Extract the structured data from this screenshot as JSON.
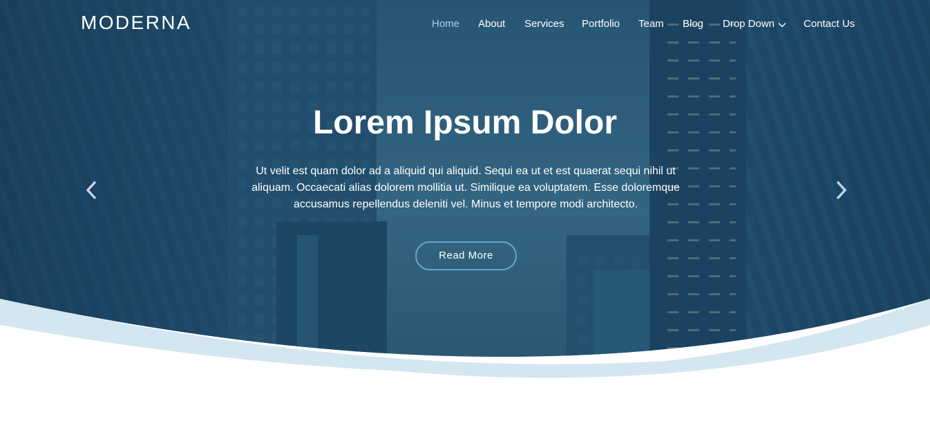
{
  "brand": {
    "logo": "MODERNA"
  },
  "nav": {
    "items": [
      {
        "label": "Home",
        "active": true
      },
      {
        "label": "About",
        "active": false
      },
      {
        "label": "Services",
        "active": false
      },
      {
        "label": "Portfolio",
        "active": false
      },
      {
        "label": "Team",
        "active": false
      },
      {
        "label": "Blog",
        "active": false
      },
      {
        "label": "Drop Down",
        "active": false,
        "icon": "chevron-down-icon"
      },
      {
        "label": "Contact Us",
        "active": false
      }
    ]
  },
  "hero": {
    "title": "Lorem Ipsum Dolor",
    "text": "Ut velit est quam dolor ad a aliquid qui aliquid. Sequi ea ut et est quaerat sequi nihil ut aliquam. Occaecati alias dolorem mollitia ut. Similique ea voluptatem. Esse doloremque accusamus repellendus deleniti vel. Minus et tempore modi architecto.",
    "button_label": "Read More",
    "prev_icon": "chevron-left-icon",
    "next_icon": "chevron-right-icon"
  },
  "colors": {
    "hero_overlay": "#1e4a6b",
    "active_nav": "#a7cfe8",
    "button_border": "#6aa6cf",
    "wave_light": "#d4e6ef",
    "background": "#ffffff"
  }
}
